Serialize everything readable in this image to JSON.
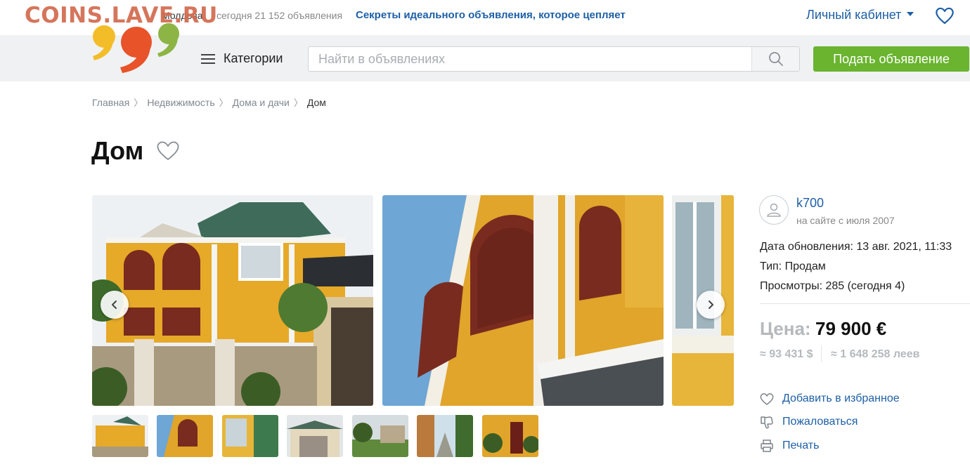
{
  "watermark": "COINS.LAVE.RU",
  "topbar": {
    "region": "Молдова",
    "ads_count": "сегодня 21 152 объявления",
    "secret_link": "Секреты идеального объявления, которое цепляет",
    "cabinet": "Личный кабинет"
  },
  "header": {
    "categories": "Категории",
    "search_placeholder": "Найти в объявлениях",
    "post_button": "Подать объявление"
  },
  "breadcrumbs": [
    "Главная",
    "Недвижимость",
    "Дома и дачи",
    "Дом"
  ],
  "listing": {
    "title": "Дом",
    "photo_count_visible": 3,
    "thumbnail_count": 7
  },
  "seller": {
    "name": "k700",
    "since": "на сайте с июля 2007"
  },
  "details": {
    "updated": "Дата обновления: 13 авг. 2021, 11:33",
    "type": "Тип: Продам",
    "views": "Просмотры: 285 (сегодня 4)"
  },
  "price": {
    "label": "Цена:",
    "value": "79 900 €",
    "usd": "≈ 93 431 $",
    "mdl": "≈ 1 648 258 леев"
  },
  "actions": {
    "favorite": "Добавить в избранное",
    "report": "Пожаловаться",
    "print": "Печать"
  },
  "colors": {
    "link": "#1d5fa6",
    "accent_green": "#6ab42f",
    "watermark": "#d26b4f",
    "header_bg": "#f0f1f3"
  },
  "icons": {
    "heart": "heart-icon",
    "search": "search-icon",
    "menu": "hamburger-icon",
    "avatar": "user-icon",
    "thumbs_down": "thumbs-down-icon",
    "print": "printer-icon"
  }
}
